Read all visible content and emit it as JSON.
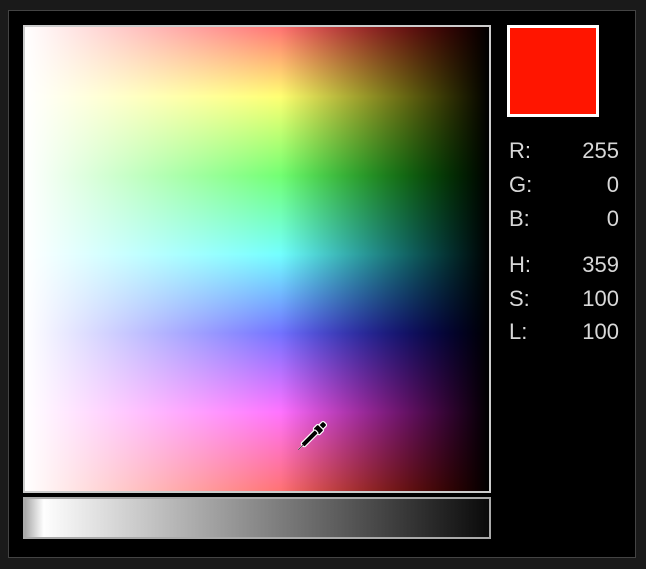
{
  "color": {
    "swatch_hex": "#ff1500",
    "rgb": {
      "r_label": "R:",
      "r_value": "255",
      "g_label": "G:",
      "g_value": "0",
      "b_label": "B:",
      "b_value": "0"
    },
    "hsl": {
      "h_label": "H:",
      "h_value": "359",
      "s_label": "S:",
      "s_value": "100",
      "l_label": "L:",
      "l_value": "100"
    }
  }
}
